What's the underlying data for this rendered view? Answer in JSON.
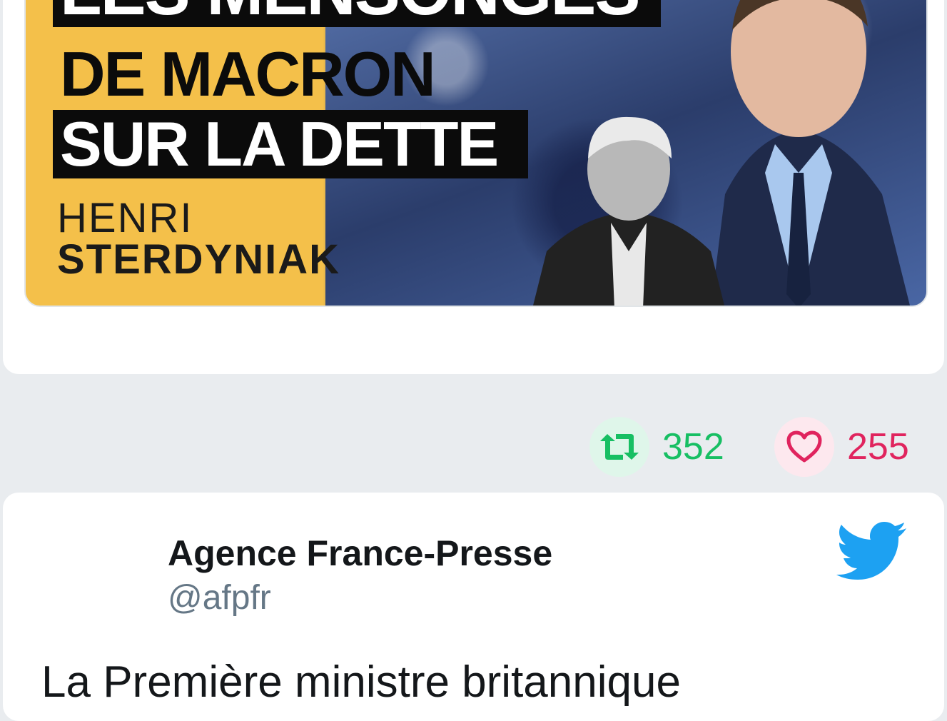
{
  "top_tweet": {
    "media": {
      "headline_lines": [
        "LES MENSONGES",
        "DE MACRON",
        "SUR LA DETTE"
      ],
      "author_first_name": "HENRI",
      "author_last_name": "STERDYNIAK"
    },
    "actions": {
      "retweet_count": "352",
      "like_count": "255"
    }
  },
  "second_tweet": {
    "author_name": "Agence France-Presse",
    "author_handle": "@afpfr",
    "text": "La Première ministre britannique"
  },
  "colors": {
    "retweet": "#17bf63",
    "like": "#e0245e",
    "twitter_blue": "#1da1f2",
    "handle_gray": "#657786"
  },
  "icons": {
    "retweet": "retweet-icon",
    "like": "heart-icon",
    "brand": "twitter-bird-icon"
  }
}
